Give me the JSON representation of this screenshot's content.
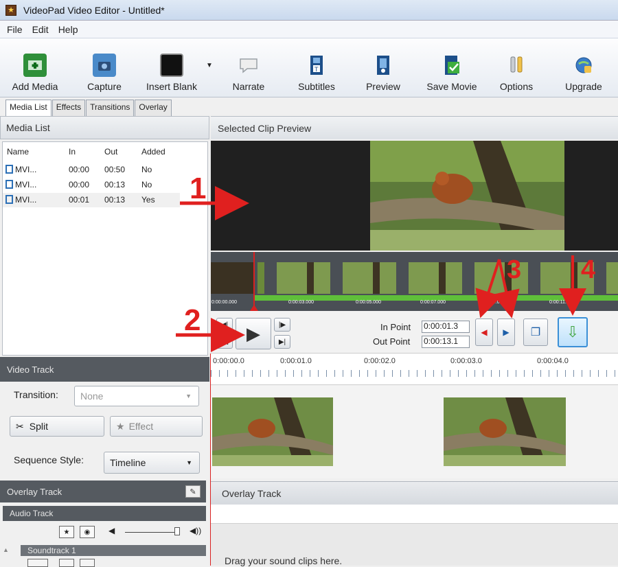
{
  "window": {
    "title": "VideoPad Video Editor - Untitled*"
  },
  "menu": [
    "File",
    "Edit",
    "Help"
  ],
  "toolbar": {
    "add_media": "Add Media",
    "capture": "Capture",
    "insert_blank": "Insert Blank",
    "narrate": "Narrate",
    "subtitles": "Subtitles",
    "preview": "Preview",
    "save_movie": "Save Movie",
    "options": "Options",
    "upgrade": "Upgrade"
  },
  "tabs": [
    "Media List",
    "Effects",
    "Transitions",
    "Overlay"
  ],
  "media_list": {
    "title": "Media List",
    "columns": [
      "Name",
      "In",
      "Out",
      "Added"
    ],
    "rows": [
      [
        "MVI...",
        "00:00",
        "00:50",
        "No"
      ],
      [
        "MVI...",
        "00:00",
        "00:13",
        "No"
      ],
      [
        "MVI...",
        "00:01",
        "00:13",
        "Yes"
      ]
    ]
  },
  "preview": {
    "title": "Selected Clip Preview",
    "filmstrip_times": [
      "0:00:00.000",
      "0:00:03.000",
      "0:00:05.000",
      "0:00:07.000",
      "0:00:09.000",
      "0:00:11.000"
    ]
  },
  "points": {
    "in_label": "In Point",
    "in_value": "0:00:01.3",
    "out_label": "Out Point",
    "out_value": "0:00:13.1"
  },
  "video_track": {
    "title": "Video Track",
    "transition_label": "Transition:",
    "transition_value": "None",
    "split": "Split",
    "effect": "Effect",
    "sequence_label": "Sequence Style:",
    "sequence_value": "Timeline"
  },
  "ruler": [
    "0:00:00.0",
    "0:00:01.0",
    "0:00:02.0",
    "0:00:03.0",
    "0:00:04.0"
  ],
  "overlay": {
    "left_title": "Overlay Track",
    "right_title": "Overlay Track"
  },
  "audio": {
    "title": "Audio Track",
    "soundtrack": "Soundtrack 1",
    "drop_hint": "Drag your sound clips here."
  },
  "annotations": [
    "1",
    "2",
    "3",
    "4"
  ],
  "colors": {
    "annotation": "#e0201f",
    "dark_bar": "#555a60"
  }
}
